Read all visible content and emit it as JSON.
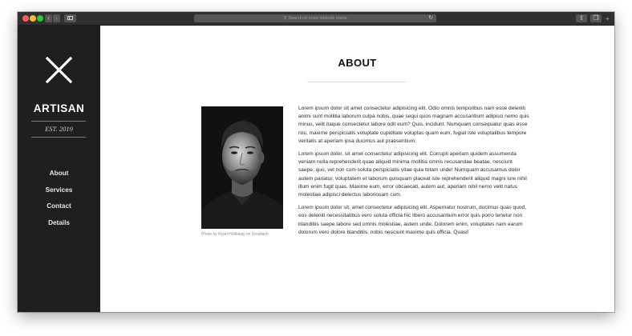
{
  "browser": {
    "address_placeholder": "Search or enter website name",
    "search_glyph": "⚲",
    "reload_glyph": "↻",
    "back_glyph": "‹",
    "forward_glyph": "›",
    "share_glyph": "⇪",
    "tabs_glyph": "❐",
    "new_tab_glyph": "+",
    "colors": {
      "toolbar": "#303030",
      "close": "#fc5f57",
      "minimize": "#fdbc2e",
      "zoom": "#28c840"
    }
  },
  "sidebar": {
    "brand": "ARTISAN",
    "established": "EST. 2019",
    "logo_icon": "x-mark-icon",
    "nav": [
      {
        "label": "About"
      },
      {
        "label": "Services"
      },
      {
        "label": "Contact"
      },
      {
        "label": "Details"
      }
    ],
    "background": "#1f1f1f"
  },
  "main": {
    "title": "ABOUT",
    "photo_caption": "Photo by Ryan Holloway on Unsplash",
    "paragraphs": [
      "Lorem ipsum dolor sit amet consectetur adipisicing elit. Odio omnis temporibus nam esse deleniti animi sunt mollitia laborum culpa nobis, quae sequi quos magnam accusantium adipisci nemo quis minus, velit itaque consectetur labore odit eum? Quis, incidunt. Numquam consequatur quas esse nisi, maxime perspiciatis voluptate cupiditate voluptas quam eum, fugiat iste voluptatibus tempore veritatis at aperiam ipsa ducimus aut praesentium.",
      "Lorem ipsum dolor, sit amet consectetur adipisicing elit. Corrupti aperiam quidem assumenda veniam nulla reprehenderit quae aliquid minima mollitia omnis recusandae beatae, nesciunt saepe, quo, vel non cum soluta perspiciatis vitae quia totam unde! Numquam accusamus dolor autem pariatur, voluptatem et laborum quisquam placeat iste reprehenderit aliquid magni iure nihil illum enim fugit quas. Maxime eum, error obcaecati, autem aut, aperiam nihil nemo velit natus molestiae adipisci delectus laboriosam cum.",
      "Lorem ipsum dolor sit, amet consectetur adipisicing elit. Aspernatur nostrum, ducimus quas quod, eos deleniti necessitatibus vero soluta officia hic libero accusantium error quis porro tenetur non blanditiis saepe labore sed omnis molestiae, autem unde. Dolorem enim, voluptates nam earum dolorum vero dolore blanditiis, nobis nesciunt maxime quis officia. Quasi!"
    ]
  }
}
